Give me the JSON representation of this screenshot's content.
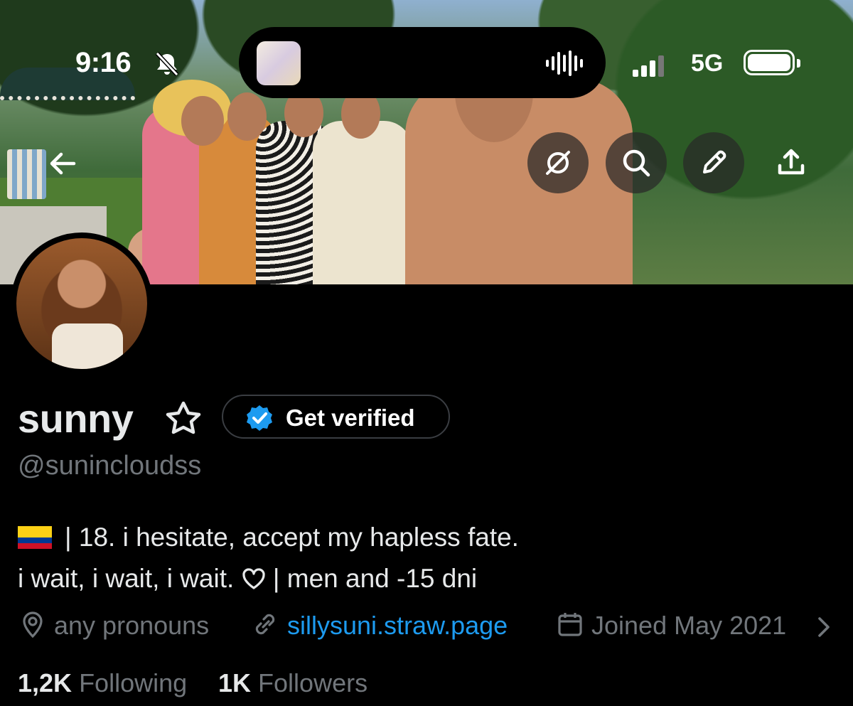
{
  "status_bar": {
    "time": "9:16",
    "network": "5G",
    "icons": [
      "bell-slash-icon",
      "waveform-icon",
      "signal-bars-icon",
      "battery-icon"
    ]
  },
  "banner_actions": {
    "icons": [
      "arrow-left-icon",
      "grok-icon",
      "search-icon",
      "pencil-icon",
      "share-icon"
    ]
  },
  "profile": {
    "display_name": "sunny",
    "name_icon": "star-outline-icon",
    "get_verified_label": "Get verified",
    "verified_badge_color": "#1d9bf0",
    "handle": "@sunincloudss",
    "bio_line1": "| 18. i hesitate, accept my hapless fate.",
    "bio_line2_before_heart": "i wait, i wait, i wait.",
    "bio_line2_after_heart": "| men and -15 dni",
    "bio_icons": [
      "colombia-flag-icon",
      "heart-outline-icon"
    ],
    "location": "any pronouns",
    "website": "sillysuni.straw.page",
    "joined": "Joined May 2021",
    "following_count": "1,2K",
    "following_label": "Following",
    "followers_count": "1K",
    "followers_label": "Followers"
  },
  "colors": {
    "background": "#000000",
    "primary_text": "#e7e9ea",
    "secondary_text": "#71767b",
    "link": "#1d9bf0"
  }
}
